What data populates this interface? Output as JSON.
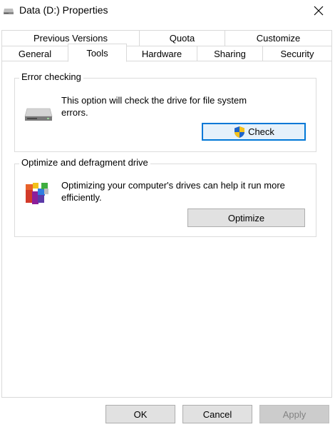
{
  "window": {
    "title": "Data (D:) Properties",
    "close_label": "close"
  },
  "tabs": {
    "row1": [
      "Previous Versions",
      "Quota",
      "Customize"
    ],
    "row2": [
      "General",
      "Tools",
      "Hardware",
      "Sharing",
      "Security"
    ],
    "active": "Tools"
  },
  "error_checking": {
    "title": "Error checking",
    "description": "This option will check the drive for file system errors.",
    "button_label": "Check",
    "icon": "drive-icon"
  },
  "optimize": {
    "title": "Optimize and defragment drive",
    "description": "Optimizing your computer's drives can help it run more efficiently.",
    "button_label": "Optimize",
    "icon": "defrag-icon"
  },
  "footer": {
    "ok_label": "OK",
    "cancel_label": "Cancel",
    "apply_label": "Apply"
  },
  "colors": {
    "focus_border": "#0078d7",
    "button_face": "#e1e1e1"
  }
}
